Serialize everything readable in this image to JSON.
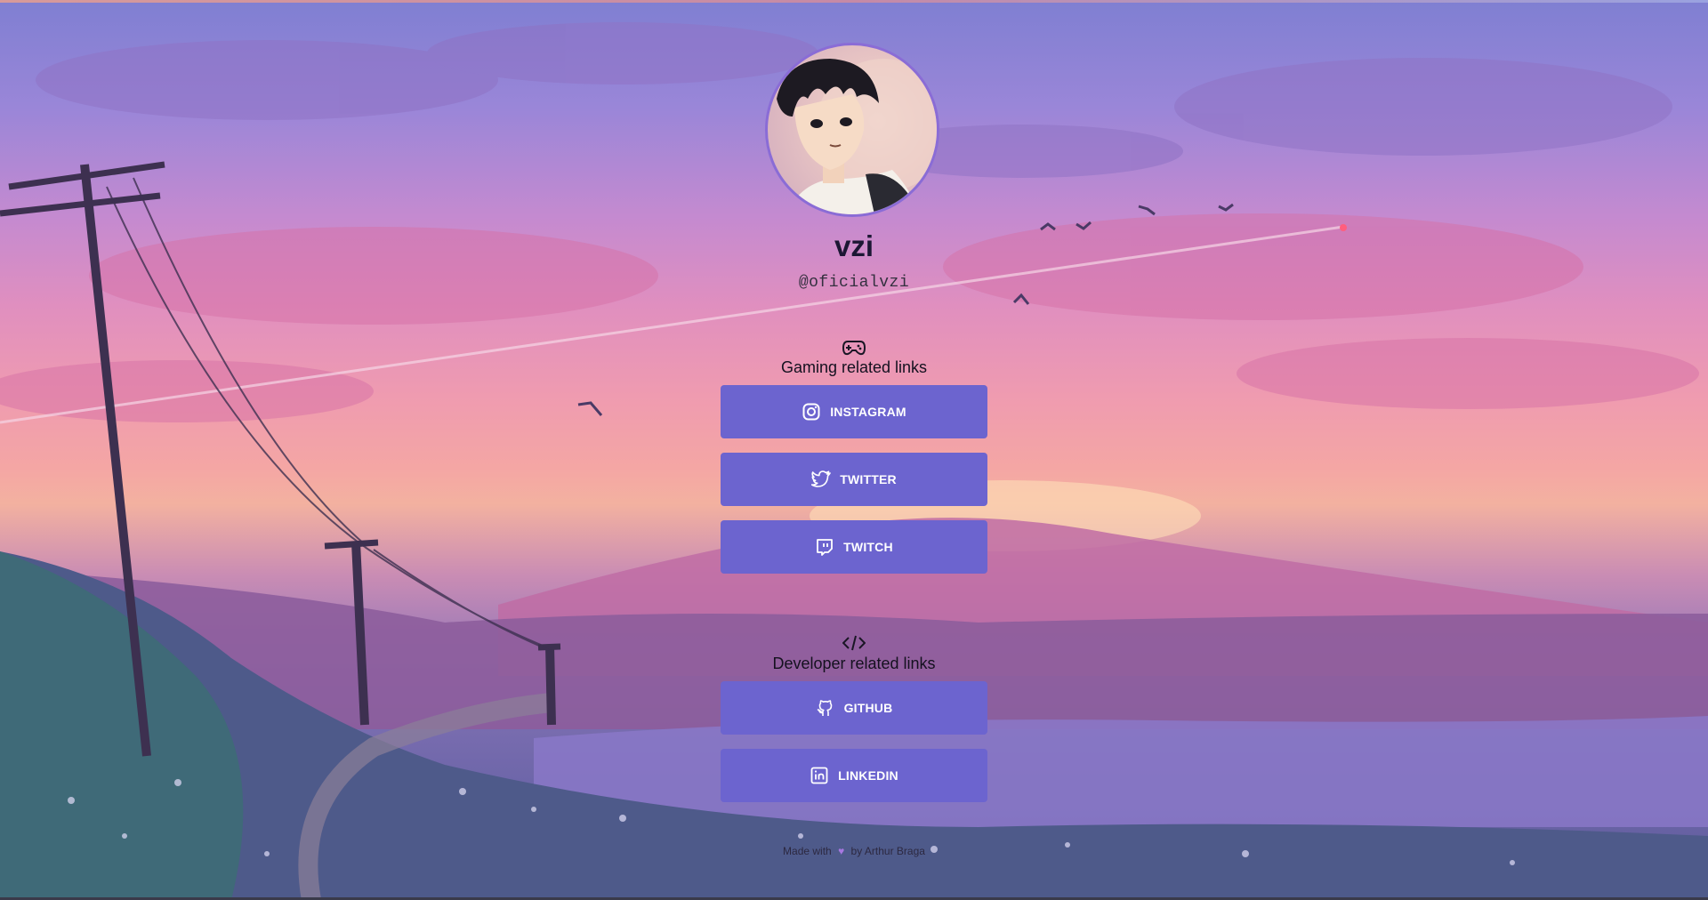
{
  "profile": {
    "name": "vzi",
    "handle": "@oficialvzi"
  },
  "sections": {
    "gaming": {
      "icon": "gamepad-icon",
      "title": "Gaming related links",
      "links": [
        {
          "label": "INSTAGRAM",
          "icon": "instagram-icon"
        },
        {
          "label": "TWITTER",
          "icon": "twitter-icon"
        },
        {
          "label": "TWITCH",
          "icon": "twitch-icon"
        }
      ]
    },
    "developer": {
      "icon": "code-icon",
      "title": "Developer related links",
      "links": [
        {
          "label": "GITHUB",
          "icon": "github-icon"
        },
        {
          "label": "LINKEDIN",
          "icon": "linkedin-icon"
        }
      ]
    }
  },
  "footer": {
    "prefix": "Made with",
    "heart_icon": "heart-icon",
    "by": "by",
    "author": "Arthur Braga"
  },
  "colors": {
    "button": "#6c64cf",
    "avatar_border": "#8a6cd6",
    "heart": "#a678e0"
  }
}
